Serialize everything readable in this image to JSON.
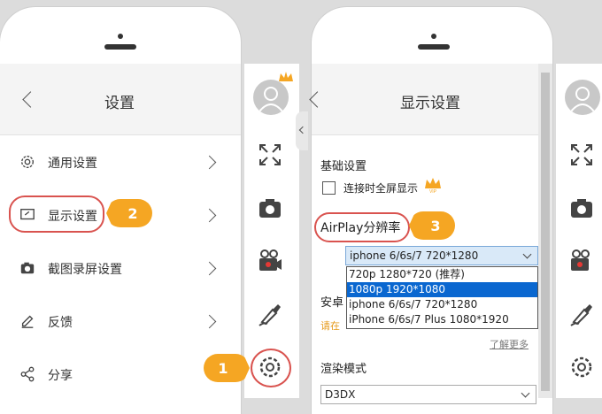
{
  "settings_panel": {
    "title": "设置",
    "menu": [
      {
        "label": "通用设置",
        "icon": "gear-icon"
      },
      {
        "label": "显示设置",
        "icon": "display-icon"
      },
      {
        "label": "截图录屏设置",
        "icon": "camera-icon"
      },
      {
        "label": "反馈",
        "icon": "pencil-icon"
      },
      {
        "label": "分享",
        "icon": "share-icon"
      }
    ]
  },
  "display_panel": {
    "title": "显示设置",
    "basic_section": "基础设置",
    "fullscreen_checkbox": "连接时全屏显示",
    "vip_badge": "VIP",
    "airplay_label": "AirPlay分辨率",
    "selected_resolution": "iphone 6/6s/7 720*1280",
    "options": [
      "720p 1280*720 (推荐)",
      "1080p 1920*1080",
      "iphone 6/6s/7 720*1280",
      "iPhone 6/6s/7 Plus 1080*1920"
    ],
    "highlighted_option_index": 1,
    "android_section_partial": "安卓",
    "android_hint_partial": "请在",
    "learn_more": "了解更多",
    "render_mode_label": "渲染模式",
    "render_mode_value": "D3DX"
  },
  "callouts": [
    "1",
    "2",
    "3"
  ],
  "colors": {
    "accent_callout": "#f5a623",
    "ring": "#d9534f",
    "selection": "#0a67d0",
    "crown": "#f5a623"
  }
}
